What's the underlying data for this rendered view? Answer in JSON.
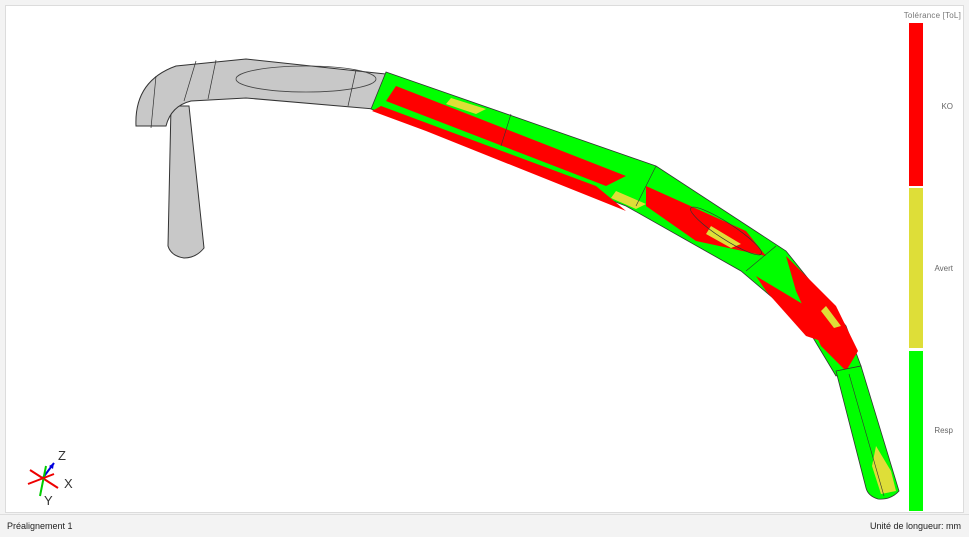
{
  "legend": {
    "title": "Tolérance [ToL]",
    "bands": [
      {
        "label": "KO",
        "color": "#ff0000"
      },
      {
        "label": "Avert",
        "color": "#dede38"
      },
      {
        "label": "Resp",
        "color": "#00ff00"
      }
    ]
  },
  "axes": {
    "z": "Z",
    "x": "X",
    "y": "Y"
  },
  "status": {
    "alignment": "Préalignement 1",
    "unit": "Unité de longueur: mm"
  },
  "colors": {
    "tube_grey": "#c8c8c8",
    "edge": "#333333",
    "ko": "#ff0000",
    "warn": "#dede38",
    "ok": "#00ff00"
  }
}
